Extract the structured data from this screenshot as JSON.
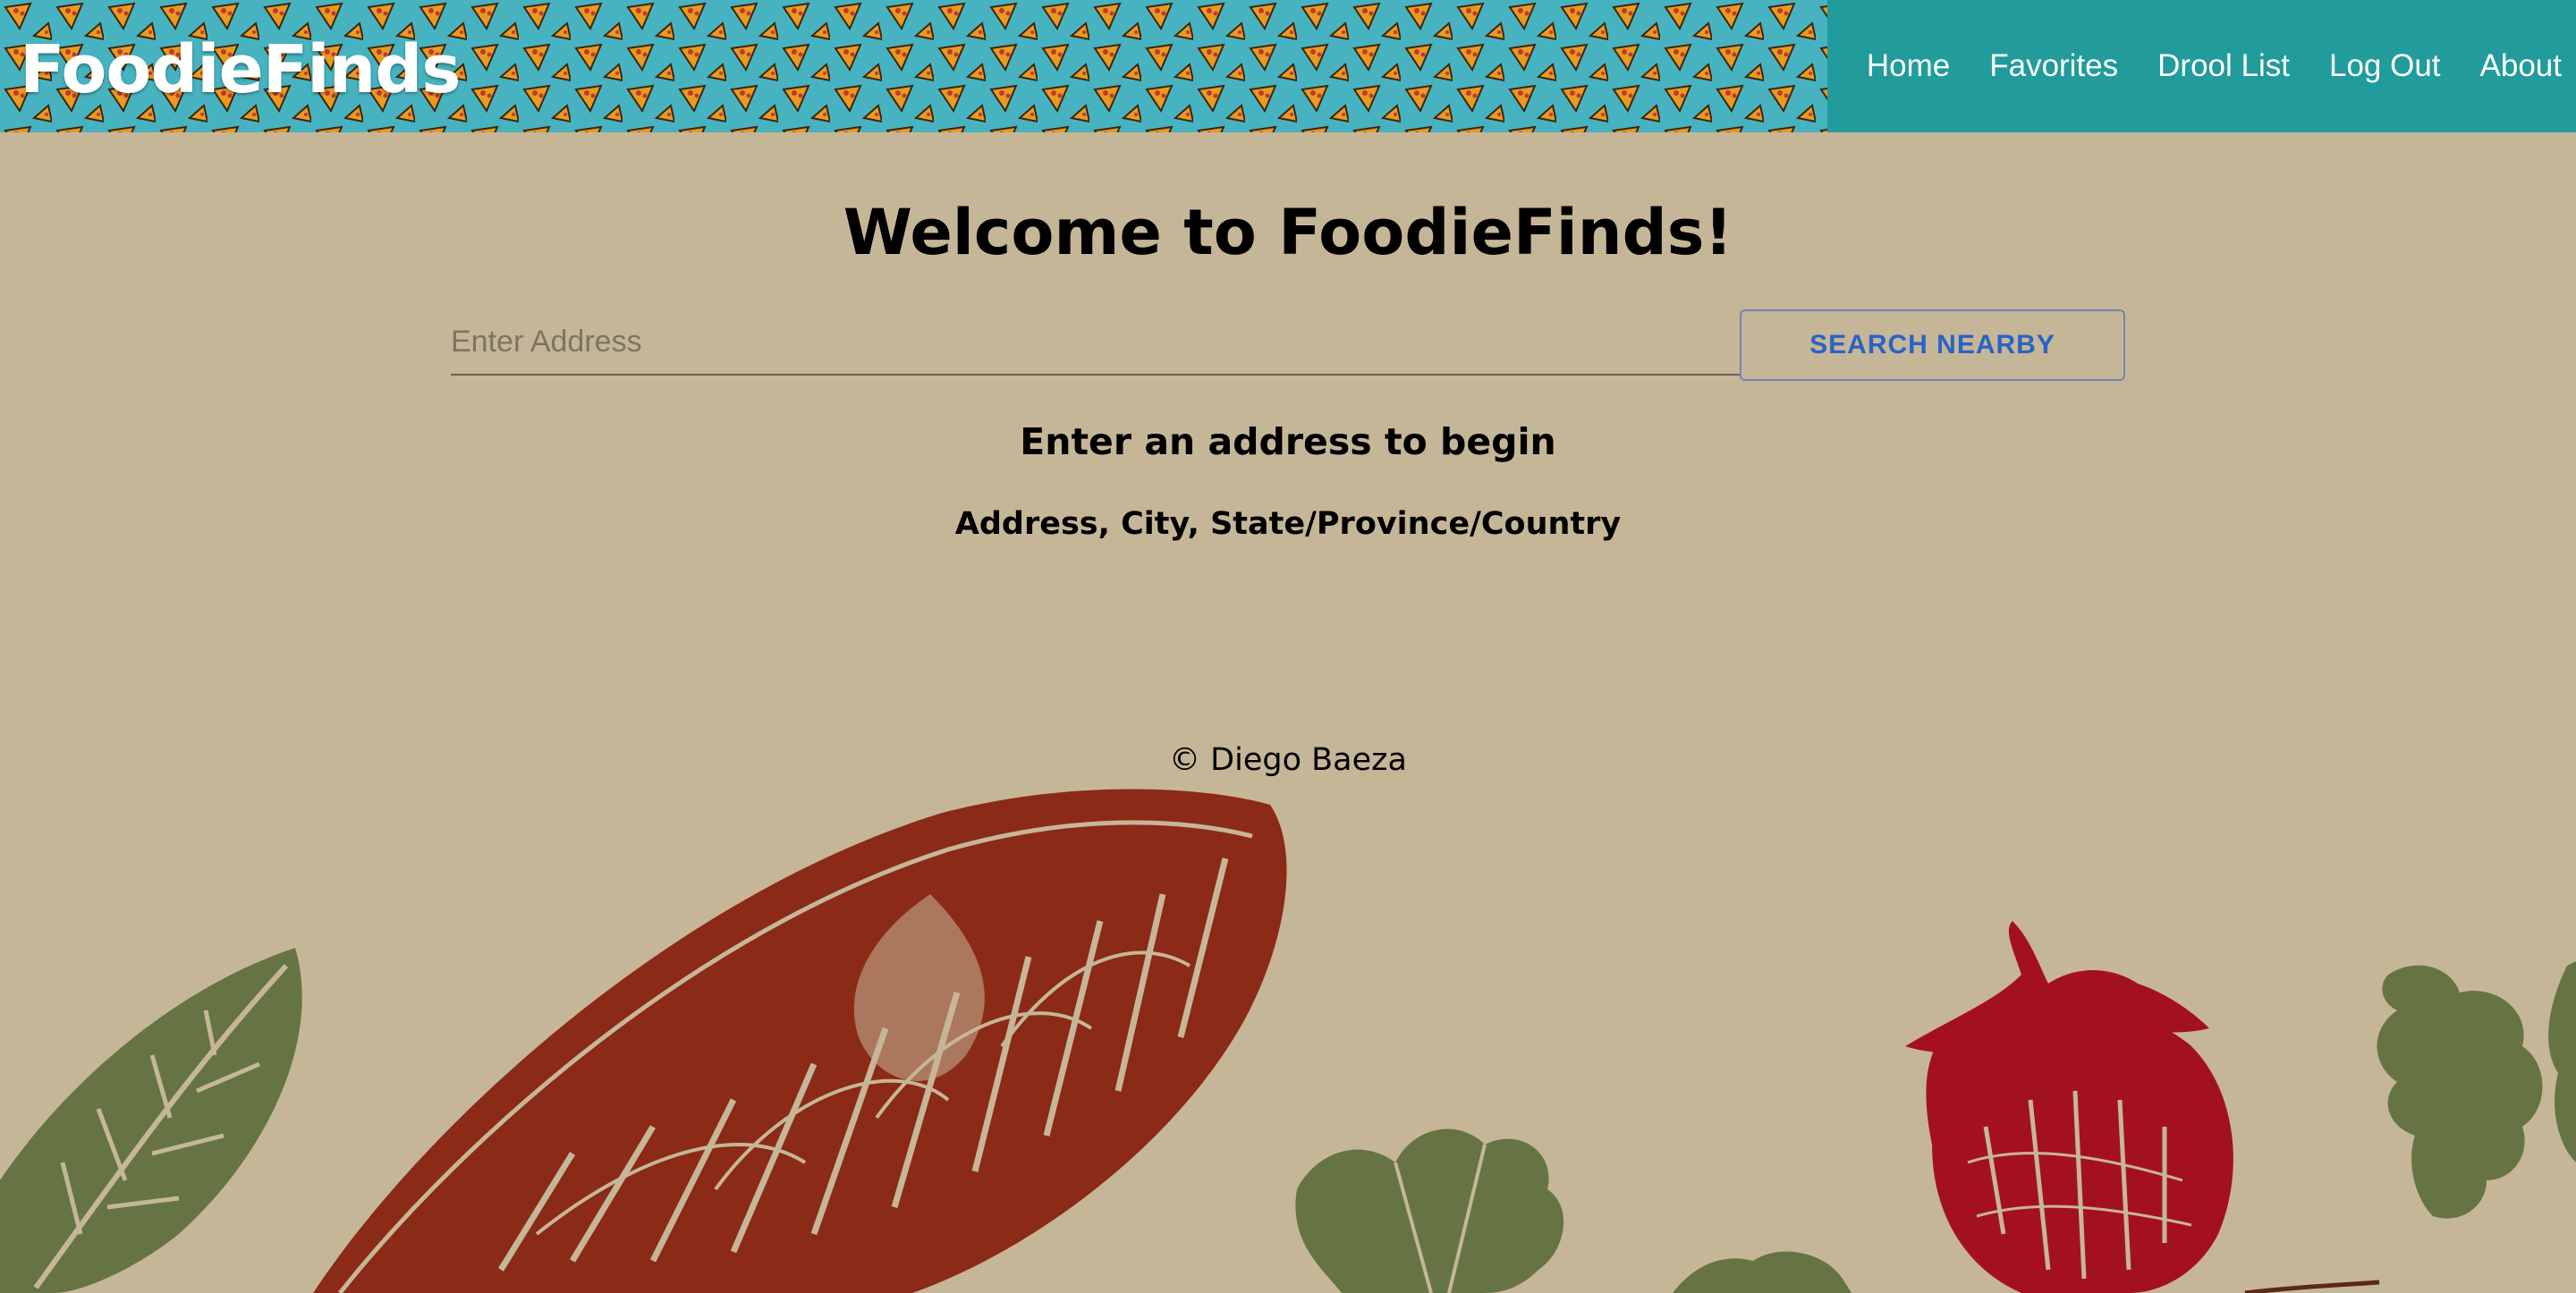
{
  "header": {
    "brand": "FoodieFinds",
    "nav": [
      "Home",
      "Favorites",
      "Drool List",
      "Log Out",
      "About"
    ]
  },
  "main": {
    "title": "Welcome to FoodieFinds!",
    "search": {
      "placeholder": "Enter Address",
      "value": "",
      "button_label": "SEARCH NEARBY"
    },
    "hint_title": "Enter an address to begin",
    "hint_format": "Address, City, State/Province/Country"
  },
  "footer": {
    "text": "© Diego Baeza"
  },
  "colors": {
    "background": "#c6b698",
    "header_pattern": "#47b3c0",
    "nav_background": "#219b9c",
    "button_text": "#2a63c4",
    "decor_red": "#8a2a17",
    "decor_green": "#667444",
    "decor_strawberry": "#a3111f"
  }
}
